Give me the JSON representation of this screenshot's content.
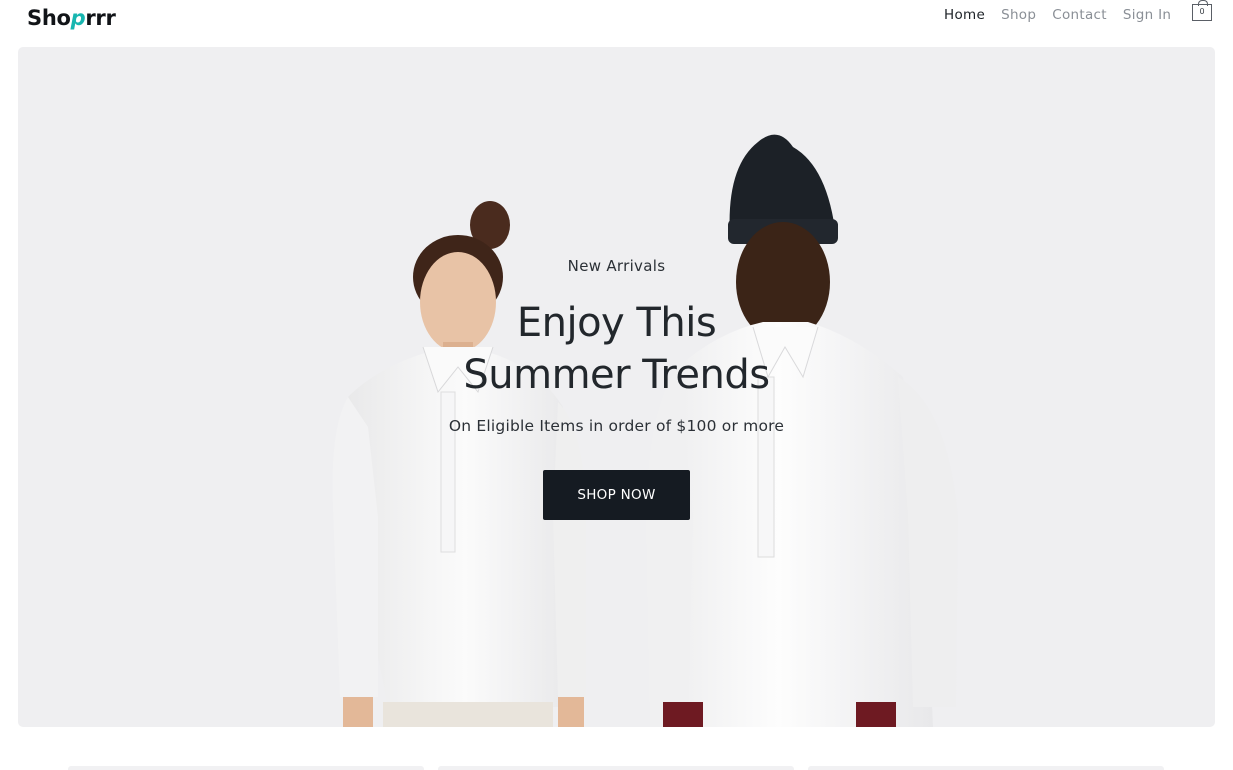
{
  "header": {
    "logo_prefix": "Sho",
    "logo_accent": "p",
    "logo_suffix": "rrr",
    "nav": [
      {
        "label": "Home",
        "active": true
      },
      {
        "label": "Shop",
        "active": false
      },
      {
        "label": "Contact",
        "active": false
      },
      {
        "label": "Sign In",
        "active": false
      }
    ],
    "cart_count": "0",
    "cart_icon": "shopping-bag-icon"
  },
  "hero": {
    "eyebrow": "New Arrivals",
    "headline_line1": "Enjoy This",
    "headline_line2": "Summer Trends",
    "subline": "On Eligible Items in order of $100 or more",
    "cta_label": "SHOP NOW"
  },
  "colors": {
    "hero_background": "#efeff1",
    "cta_background": "#151b22",
    "logo_accent": "#17b6b0",
    "nav_active": "#1d2227",
    "nav_inactive": "#8a8f96"
  }
}
